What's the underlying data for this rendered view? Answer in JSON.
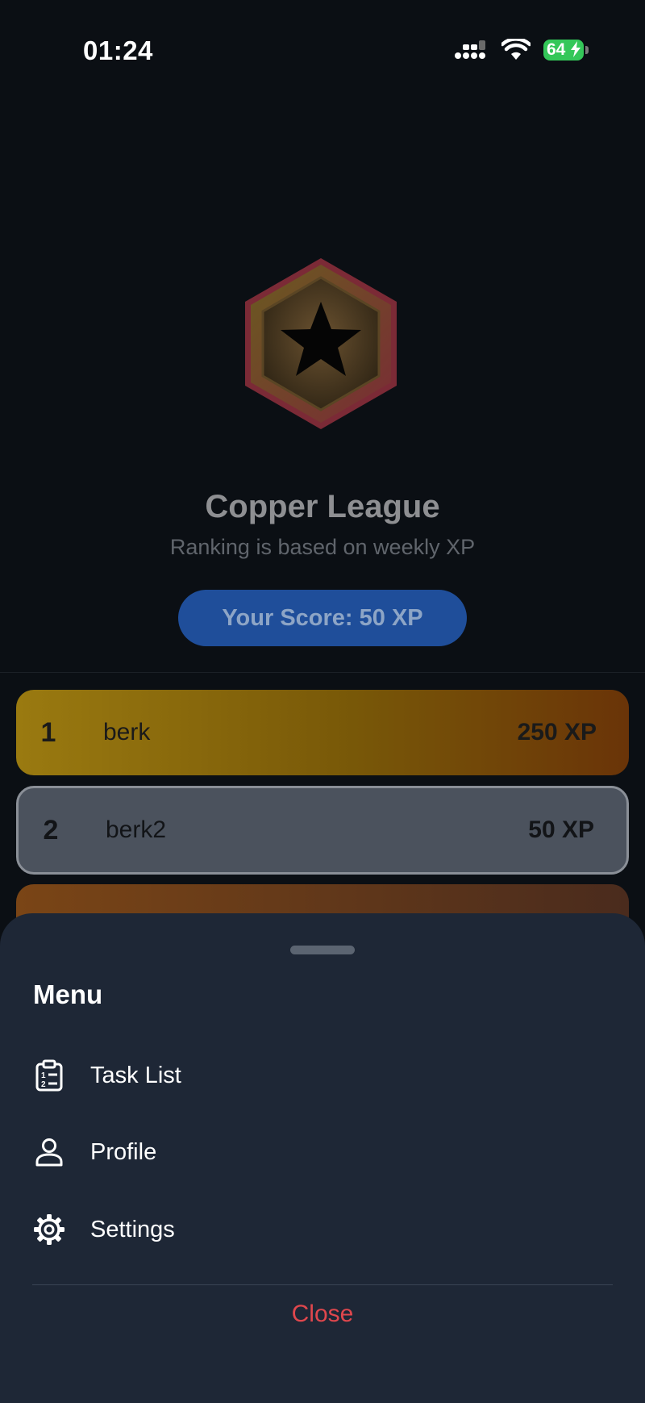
{
  "status_bar": {
    "time": "01:24",
    "battery": "64"
  },
  "league": {
    "title": "Copper League",
    "subtitle": "Ranking is based on weekly XP",
    "score_label": "Your Score: 50 XP",
    "badge_icon": "star-hexagon-icon"
  },
  "leaderboard": {
    "rows": [
      {
        "rank": "1",
        "name": "berk",
        "xp": "250 XP"
      },
      {
        "rank": "2",
        "name": "berk2",
        "xp": "50 XP"
      }
    ]
  },
  "menu": {
    "title": "Menu",
    "items": [
      {
        "label": "Task List",
        "icon": "clipboard-list-icon"
      },
      {
        "label": "Profile",
        "icon": "person-icon"
      },
      {
        "label": "Settings",
        "icon": "gear-icon"
      }
    ],
    "close_label": "Close"
  },
  "colors": {
    "accent_blue": "#1f4e9a",
    "gold": "#9a7a10",
    "silver": "#4b525d",
    "sheet_bg": "#1e2736",
    "danger": "#e0474d"
  }
}
